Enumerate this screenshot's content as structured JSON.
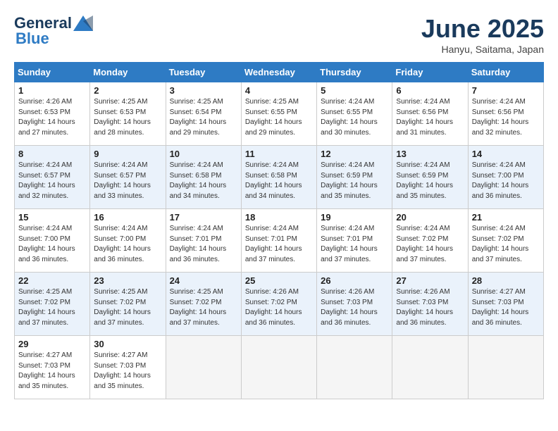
{
  "header": {
    "logo_general": "General",
    "logo_blue": "Blue",
    "title": "June 2025",
    "location": "Hanyu, Saitama, Japan"
  },
  "days_of_week": [
    "Sunday",
    "Monday",
    "Tuesday",
    "Wednesday",
    "Thursday",
    "Friday",
    "Saturday"
  ],
  "weeks": [
    [
      {
        "num": "1",
        "sunrise": "Sunrise: 4:26 AM",
        "sunset": "Sunset: 6:53 PM",
        "daylight": "Daylight: 14 hours and 27 minutes."
      },
      {
        "num": "2",
        "sunrise": "Sunrise: 4:25 AM",
        "sunset": "Sunset: 6:53 PM",
        "daylight": "Daylight: 14 hours and 28 minutes."
      },
      {
        "num": "3",
        "sunrise": "Sunrise: 4:25 AM",
        "sunset": "Sunset: 6:54 PM",
        "daylight": "Daylight: 14 hours and 29 minutes."
      },
      {
        "num": "4",
        "sunrise": "Sunrise: 4:25 AM",
        "sunset": "Sunset: 6:55 PM",
        "daylight": "Daylight: 14 hours and 29 minutes."
      },
      {
        "num": "5",
        "sunrise": "Sunrise: 4:24 AM",
        "sunset": "Sunset: 6:55 PM",
        "daylight": "Daylight: 14 hours and 30 minutes."
      },
      {
        "num": "6",
        "sunrise": "Sunrise: 4:24 AM",
        "sunset": "Sunset: 6:56 PM",
        "daylight": "Daylight: 14 hours and 31 minutes."
      },
      {
        "num": "7",
        "sunrise": "Sunrise: 4:24 AM",
        "sunset": "Sunset: 6:56 PM",
        "daylight": "Daylight: 14 hours and 32 minutes."
      }
    ],
    [
      {
        "num": "8",
        "sunrise": "Sunrise: 4:24 AM",
        "sunset": "Sunset: 6:57 PM",
        "daylight": "Daylight: 14 hours and 32 minutes."
      },
      {
        "num": "9",
        "sunrise": "Sunrise: 4:24 AM",
        "sunset": "Sunset: 6:57 PM",
        "daylight": "Daylight: 14 hours and 33 minutes."
      },
      {
        "num": "10",
        "sunrise": "Sunrise: 4:24 AM",
        "sunset": "Sunset: 6:58 PM",
        "daylight": "Daylight: 14 hours and 34 minutes."
      },
      {
        "num": "11",
        "sunrise": "Sunrise: 4:24 AM",
        "sunset": "Sunset: 6:58 PM",
        "daylight": "Daylight: 14 hours and 34 minutes."
      },
      {
        "num": "12",
        "sunrise": "Sunrise: 4:24 AM",
        "sunset": "Sunset: 6:59 PM",
        "daylight": "Daylight: 14 hours and 35 minutes."
      },
      {
        "num": "13",
        "sunrise": "Sunrise: 4:24 AM",
        "sunset": "Sunset: 6:59 PM",
        "daylight": "Daylight: 14 hours and 35 minutes."
      },
      {
        "num": "14",
        "sunrise": "Sunrise: 4:24 AM",
        "sunset": "Sunset: 7:00 PM",
        "daylight": "Daylight: 14 hours and 36 minutes."
      }
    ],
    [
      {
        "num": "15",
        "sunrise": "Sunrise: 4:24 AM",
        "sunset": "Sunset: 7:00 PM",
        "daylight": "Daylight: 14 hours and 36 minutes."
      },
      {
        "num": "16",
        "sunrise": "Sunrise: 4:24 AM",
        "sunset": "Sunset: 7:00 PM",
        "daylight": "Daylight: 14 hours and 36 minutes."
      },
      {
        "num": "17",
        "sunrise": "Sunrise: 4:24 AM",
        "sunset": "Sunset: 7:01 PM",
        "daylight": "Daylight: 14 hours and 36 minutes."
      },
      {
        "num": "18",
        "sunrise": "Sunrise: 4:24 AM",
        "sunset": "Sunset: 7:01 PM",
        "daylight": "Daylight: 14 hours and 37 minutes."
      },
      {
        "num": "19",
        "sunrise": "Sunrise: 4:24 AM",
        "sunset": "Sunset: 7:01 PM",
        "daylight": "Daylight: 14 hours and 37 minutes."
      },
      {
        "num": "20",
        "sunrise": "Sunrise: 4:24 AM",
        "sunset": "Sunset: 7:02 PM",
        "daylight": "Daylight: 14 hours and 37 minutes."
      },
      {
        "num": "21",
        "sunrise": "Sunrise: 4:24 AM",
        "sunset": "Sunset: 7:02 PM",
        "daylight": "Daylight: 14 hours and 37 minutes."
      }
    ],
    [
      {
        "num": "22",
        "sunrise": "Sunrise: 4:25 AM",
        "sunset": "Sunset: 7:02 PM",
        "daylight": "Daylight: 14 hours and 37 minutes."
      },
      {
        "num": "23",
        "sunrise": "Sunrise: 4:25 AM",
        "sunset": "Sunset: 7:02 PM",
        "daylight": "Daylight: 14 hours and 37 minutes."
      },
      {
        "num": "24",
        "sunrise": "Sunrise: 4:25 AM",
        "sunset": "Sunset: 7:02 PM",
        "daylight": "Daylight: 14 hours and 37 minutes."
      },
      {
        "num": "25",
        "sunrise": "Sunrise: 4:26 AM",
        "sunset": "Sunset: 7:02 PM",
        "daylight": "Daylight: 14 hours and 36 minutes."
      },
      {
        "num": "26",
        "sunrise": "Sunrise: 4:26 AM",
        "sunset": "Sunset: 7:03 PM",
        "daylight": "Daylight: 14 hours and 36 minutes."
      },
      {
        "num": "27",
        "sunrise": "Sunrise: 4:26 AM",
        "sunset": "Sunset: 7:03 PM",
        "daylight": "Daylight: 14 hours and 36 minutes."
      },
      {
        "num": "28",
        "sunrise": "Sunrise: 4:27 AM",
        "sunset": "Sunset: 7:03 PM",
        "daylight": "Daylight: 14 hours and 36 minutes."
      }
    ],
    [
      {
        "num": "29",
        "sunrise": "Sunrise: 4:27 AM",
        "sunset": "Sunset: 7:03 PM",
        "daylight": "Daylight: 14 hours and 35 minutes."
      },
      {
        "num": "30",
        "sunrise": "Sunrise: 4:27 AM",
        "sunset": "Sunset: 7:03 PM",
        "daylight": "Daylight: 14 hours and 35 minutes."
      },
      null,
      null,
      null,
      null,
      null
    ]
  ]
}
